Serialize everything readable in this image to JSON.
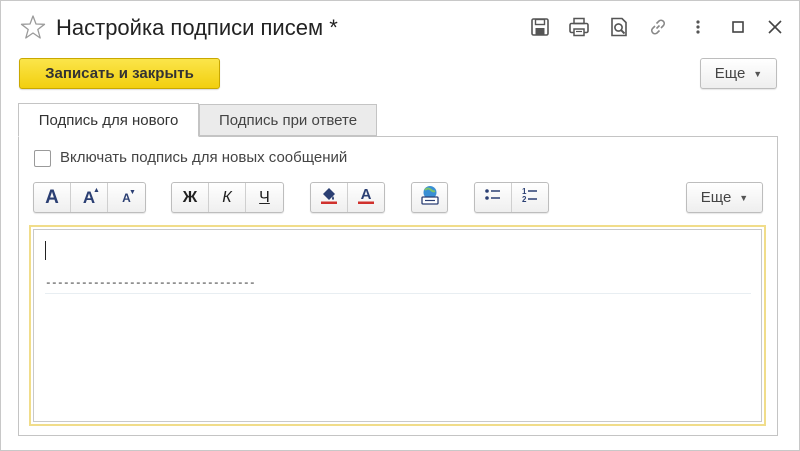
{
  "window": {
    "title": "Настройка подписи писем *",
    "icons": [
      "star-icon",
      "save-icon",
      "print-icon",
      "preview-icon",
      "link-icon",
      "more-vert-icon",
      "maximize-icon",
      "close-icon"
    ]
  },
  "toolbar": {
    "save_close_label": "Записать и закрыть",
    "more_label": "Еще"
  },
  "tabs": [
    {
      "label": "Подпись для нового",
      "active": true
    },
    {
      "label": "Подпись при ответе",
      "active": false
    }
  ],
  "signature": {
    "include_label": "Включать подпись для новых сообщений",
    "include_checked": false
  },
  "format_toolbar": {
    "font_buttons": [
      "A",
      "A",
      "A"
    ],
    "bold_label": "Ж",
    "italic_label": "К",
    "underline_label": "Ч",
    "more_label": "Еще"
  },
  "editor": {
    "separator_text": "-----------------------------------"
  },
  "colors": {
    "accent_yellow": "#f5d422",
    "icon_blue": "#2b3f73",
    "text_red": "#d0312d"
  }
}
